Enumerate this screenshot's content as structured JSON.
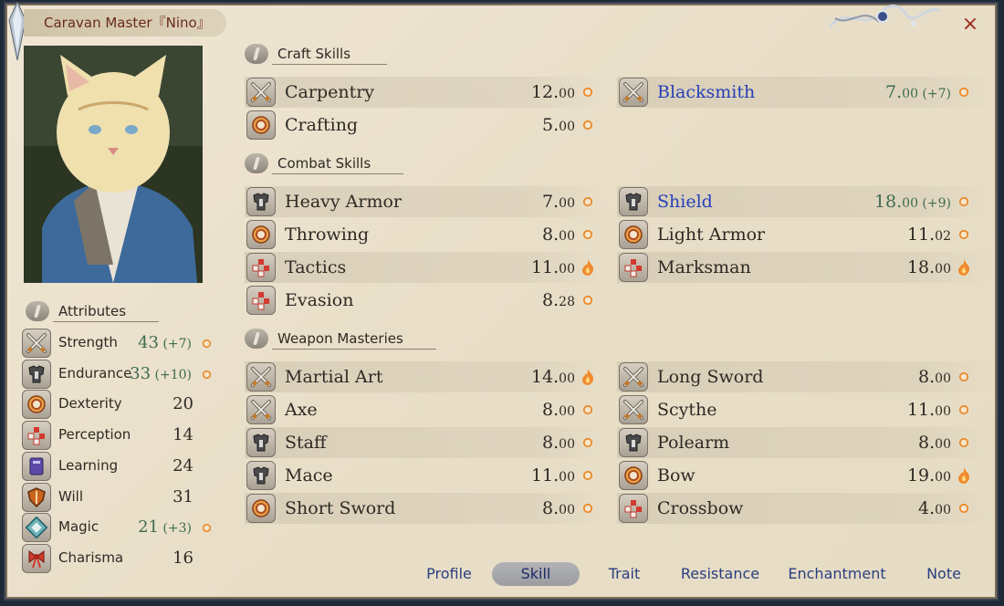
{
  "window": {
    "title": "Caravan Master『Nino』",
    "close_glyph": "×"
  },
  "attributes": {
    "header": "Attributes",
    "items": [
      {
        "label": "Strength",
        "value": "43",
        "bonus": "(+7)",
        "icon": "crossed-swords-icon",
        "green": true,
        "potential": true
      },
      {
        "label": "Endurance",
        "value": "33",
        "bonus": "(+10)",
        "icon": "armor-icon",
        "green": true,
        "potential": true
      },
      {
        "label": "Dexterity",
        "value": "20",
        "bonus": "",
        "icon": "ring-icon",
        "green": false,
        "potential": false
      },
      {
        "label": "Perception",
        "value": "14",
        "bonus": "",
        "icon": "dots-icon",
        "green": false,
        "potential": false
      },
      {
        "label": "Learning",
        "value": "24",
        "bonus": "",
        "icon": "book-icon",
        "green": false,
        "potential": false
      },
      {
        "label": "Will",
        "value": "31",
        "bonus": "",
        "icon": "shield-icon",
        "green": false,
        "potential": false
      },
      {
        "label": "Magic",
        "value": "21",
        "bonus": "(+3)",
        "icon": "rune-icon",
        "green": true,
        "potential": true
      },
      {
        "label": "Charisma",
        "value": "16",
        "bonus": "",
        "icon": "ribbon-icon",
        "green": false,
        "potential": false
      }
    ]
  },
  "sections": [
    {
      "header": "Craft Skills",
      "skills": [
        {
          "name": "Carpentry",
          "value": "12.",
          "dec": "00",
          "bonus": "",
          "icon": "crossed-swords-icon",
          "potential": "circle",
          "blue": false,
          "green": false
        },
        {
          "name": "Blacksmith",
          "value": "7.",
          "dec": "00",
          "bonus": " (+7)",
          "icon": "crossed-swords-icon",
          "potential": "circle",
          "blue": true,
          "green": true
        },
        {
          "name": "Crafting",
          "value": "5.",
          "dec": "00",
          "bonus": "",
          "icon": "ring-icon",
          "potential": "circle",
          "blue": false,
          "green": false
        }
      ]
    },
    {
      "header": "Combat Skills",
      "skills": [
        {
          "name": "Heavy Armor",
          "value": "7.",
          "dec": "00",
          "bonus": "",
          "icon": "armor-icon",
          "potential": "circle",
          "blue": false,
          "green": false
        },
        {
          "name": "Shield",
          "value": "18.",
          "dec": "00",
          "bonus": " (+9)",
          "icon": "armor-icon",
          "potential": "circle",
          "blue": true,
          "green": true
        },
        {
          "name": "Throwing",
          "value": "8.",
          "dec": "00",
          "bonus": "",
          "icon": "ring-icon",
          "potential": "circle",
          "blue": false,
          "green": false
        },
        {
          "name": "Light Armor",
          "value": "11.",
          "dec": "02",
          "bonus": "",
          "icon": "ring-icon",
          "potential": "circle",
          "blue": false,
          "green": false
        },
        {
          "name": "Tactics",
          "value": "11.",
          "dec": "00",
          "bonus": "",
          "icon": "dots-icon",
          "potential": "flame",
          "blue": false,
          "green": false
        },
        {
          "name": "Marksman",
          "value": "18.",
          "dec": "00",
          "bonus": "",
          "icon": "dots-icon",
          "potential": "flame",
          "blue": false,
          "green": false
        },
        {
          "name": "Evasion",
          "value": "8.",
          "dec": "28",
          "bonus": "",
          "icon": "dots-icon",
          "potential": "circle",
          "blue": false,
          "green": false
        }
      ]
    },
    {
      "header": "Weapon Masteries",
      "skills": [
        {
          "name": "Martial Art",
          "value": "14.",
          "dec": "00",
          "bonus": "",
          "icon": "crossed-swords-icon",
          "potential": "flame",
          "blue": false,
          "green": false
        },
        {
          "name": "Long Sword",
          "value": "8.",
          "dec": "00",
          "bonus": "",
          "icon": "crossed-swords-icon",
          "potential": "circle",
          "blue": false,
          "green": false
        },
        {
          "name": "Axe",
          "value": "8.",
          "dec": "00",
          "bonus": "",
          "icon": "crossed-swords-icon",
          "potential": "circle",
          "blue": false,
          "green": false
        },
        {
          "name": "Scythe",
          "value": "11.",
          "dec": "00",
          "bonus": "",
          "icon": "crossed-swords-icon",
          "potential": "circle",
          "blue": false,
          "green": false
        },
        {
          "name": "Staff",
          "value": "8.",
          "dec": "00",
          "bonus": "",
          "icon": "armor-icon",
          "potential": "circle",
          "blue": false,
          "green": false
        },
        {
          "name": "Polearm",
          "value": "8.",
          "dec": "00",
          "bonus": "",
          "icon": "armor-icon",
          "potential": "circle",
          "blue": false,
          "green": false
        },
        {
          "name": "Mace",
          "value": "11.",
          "dec": "00",
          "bonus": "",
          "icon": "armor-icon",
          "potential": "circle",
          "blue": false,
          "green": false
        },
        {
          "name": "Bow",
          "value": "19.",
          "dec": "00",
          "bonus": "",
          "icon": "ring-icon",
          "potential": "flame",
          "blue": false,
          "green": false
        },
        {
          "name": "Short Sword",
          "value": "8.",
          "dec": "00",
          "bonus": "",
          "icon": "ring-icon",
          "potential": "circle",
          "blue": false,
          "green": false
        },
        {
          "name": "Crossbow",
          "value": "4.",
          "dec": "00",
          "bonus": "",
          "icon": "dots-icon",
          "potential": "circle",
          "blue": false,
          "green": false
        }
      ]
    }
  ],
  "tabs": [
    {
      "label": "Profile",
      "active": false
    },
    {
      "label": "Skill",
      "active": true
    },
    {
      "label": "Trait",
      "active": false
    },
    {
      "label": "Resistance",
      "active": false
    },
    {
      "label": "Enchantment",
      "active": false
    },
    {
      "label": "Note",
      "active": false
    }
  ],
  "colors": {
    "blue_skill": "#2540b8",
    "green_value": "#3d6b50",
    "potential": "#e88a2c",
    "title_text": "#6a2a1c"
  }
}
